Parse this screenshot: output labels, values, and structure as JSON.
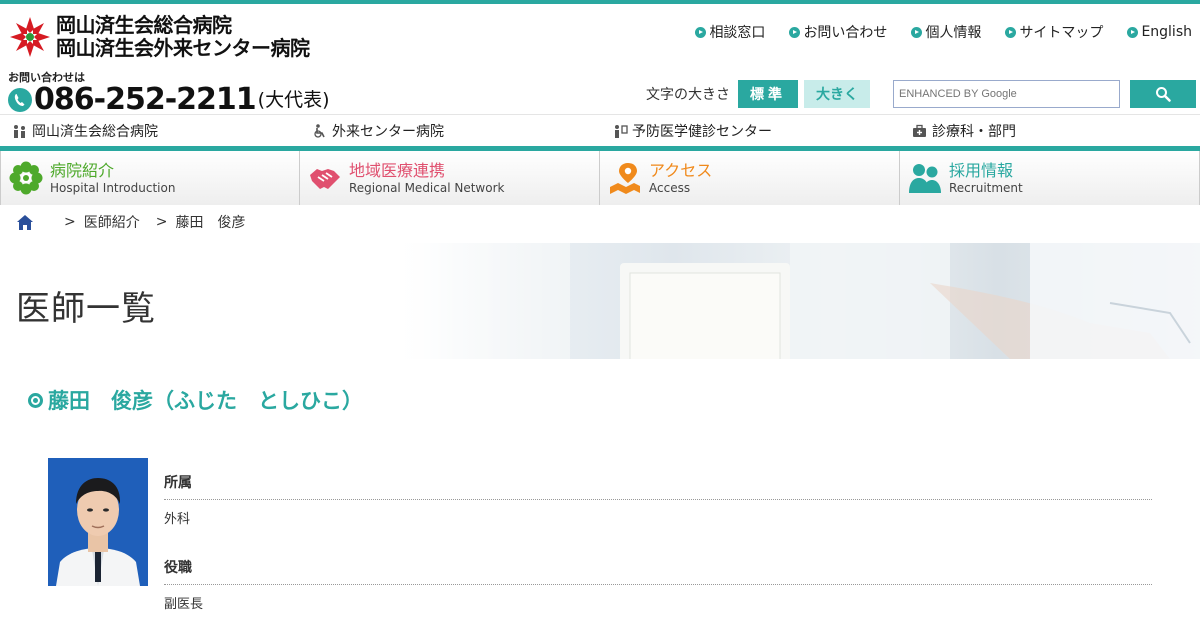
{
  "logo": {
    "line1": "岡山済生会総合病院",
    "line2": "岡山済生会外来センター病院"
  },
  "phone": {
    "label": "お問い合わせは",
    "number": "086-252-2211",
    "suffix": "(大代表)"
  },
  "utility_links": [
    {
      "label": "相談窓口"
    },
    {
      "label": "お問い合わせ"
    },
    {
      "label": "個人情報"
    },
    {
      "label": "サイトマップ"
    },
    {
      "label": "English"
    }
  ],
  "font_size": {
    "label": "文字の大きさ",
    "standard": "標準",
    "large": "大きく"
  },
  "search": {
    "placeholder": "ENHANCED BY Google"
  },
  "sub_nav": [
    {
      "label": "岡山済生会総合病院"
    },
    {
      "label": "外来センター病院"
    },
    {
      "label": "予防医学健診センター"
    },
    {
      "label": "診療科・部門"
    }
  ],
  "main_nav": [
    {
      "jp": "病院紹介",
      "en": "Hospital Introduction",
      "color": "#4ea92b"
    },
    {
      "jp": "地域医療連携",
      "en": "Regional Medical Network",
      "color": "#e0506f"
    },
    {
      "jp": "アクセス",
      "en": "Access",
      "color": "#f08a1c"
    },
    {
      "jp": "採用情報",
      "en": "Recruitment",
      "color": "#2aa8a0"
    }
  ],
  "breadcrumb": {
    "sep1": ">",
    "item1": "医師紹介",
    "sep2": ">",
    "item2": "藤田　俊彦"
  },
  "hero": {
    "title": "医師一覧"
  },
  "doctor": {
    "name": "藤田　俊彦（ふじた　としひこ）",
    "fields": [
      {
        "label": "所属",
        "value": "外科"
      },
      {
        "label": "役職",
        "value": "副医長"
      }
    ]
  },
  "colors": {
    "accent": "#2aa8a0"
  }
}
